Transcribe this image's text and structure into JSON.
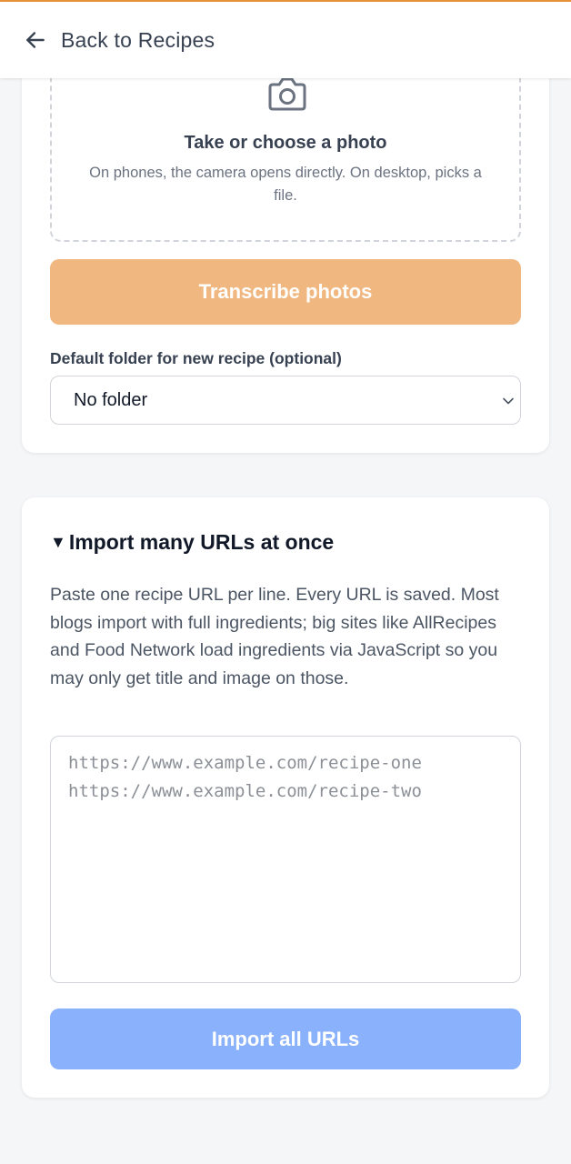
{
  "header": {
    "back_label": "Back to Recipes"
  },
  "photo_card": {
    "dropzone_title": "Take or choose a photo",
    "dropzone_subtitle": "On phones, the camera opens directly. On desktop, picks a file.",
    "transcribe_button": "Transcribe photos",
    "folder_label": "Default folder for new recipe (optional)",
    "folder_selected": "No folder"
  },
  "bulk_card": {
    "toggle_symbol": "▼",
    "title": "Import many URLs at once",
    "description": "Paste one recipe URL per line. Every URL is saved. Most blogs import with full ingredients; big sites like AllRecipes and Food Network load ingredients via JavaScript so you may only get title and image on those.",
    "textarea_placeholder": "https://www.example.com/recipe-one\nhttps://www.example.com/recipe-two",
    "import_button": "Import all URLs"
  },
  "colors": {
    "accent": "#e8923a",
    "transcribe_button": "#f0b880",
    "import_button": "#8ab1fb"
  },
  "icons": [
    "back-arrow-icon",
    "camera-icon",
    "chevron-down-icon",
    "triangle-down-icon"
  ]
}
